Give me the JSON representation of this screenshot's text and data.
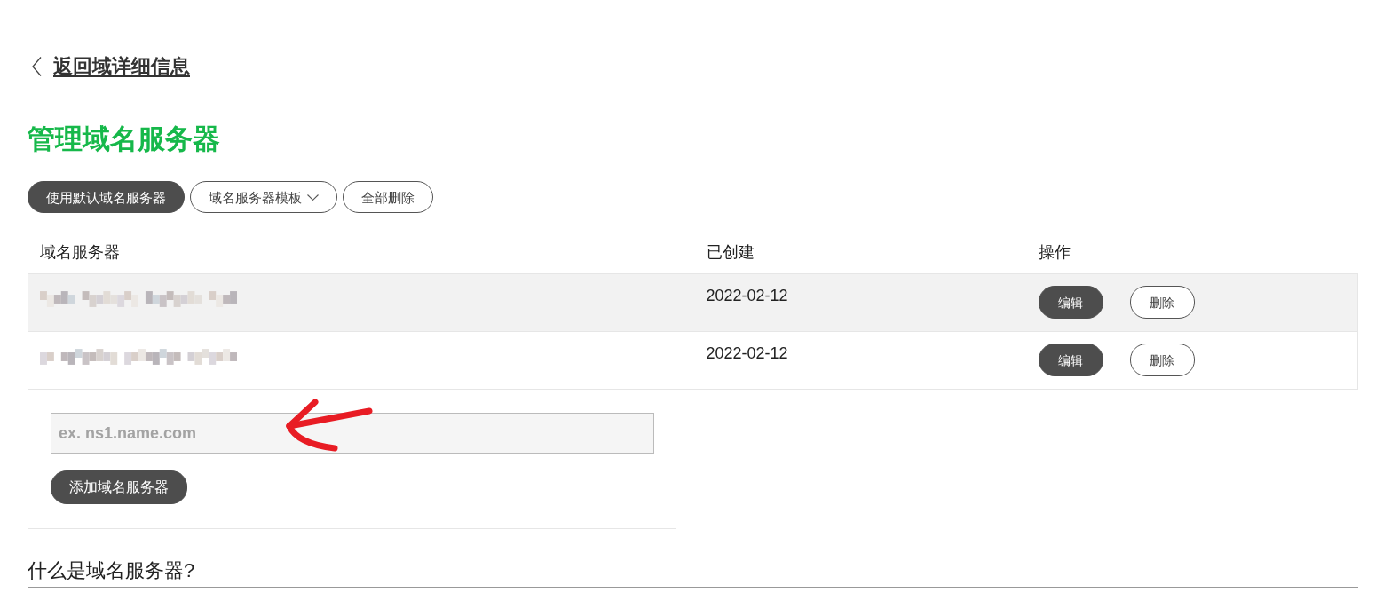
{
  "back_link": {
    "label": "返回域详细信息"
  },
  "title": "管理域名服务器",
  "toolbar": [
    {
      "label": "使用默认域名服务器",
      "kind": "filled",
      "dropdown": false
    },
    {
      "label": "域名服务器模板",
      "kind": "outline",
      "dropdown": true
    },
    {
      "label": "全部删除",
      "kind": "outline",
      "dropdown": false
    }
  ],
  "table": {
    "columns": [
      "域名服务器",
      "已创建",
      "操作"
    ],
    "rows": [
      {
        "created": "2022-02-12",
        "actions": [
          {
            "label": "编辑",
            "kind": "filled"
          },
          {
            "label": "删除",
            "kind": "outline"
          }
        ]
      },
      {
        "created": "2022-02-12",
        "actions": [
          {
            "label": "编辑",
            "kind": "filled"
          },
          {
            "label": "删除",
            "kind": "outline"
          }
        ]
      }
    ]
  },
  "add_form": {
    "placeholder": "ex. ns1.name.com",
    "button": "添加域名服务器"
  },
  "section_heading": "什么是域名服务器?"
}
